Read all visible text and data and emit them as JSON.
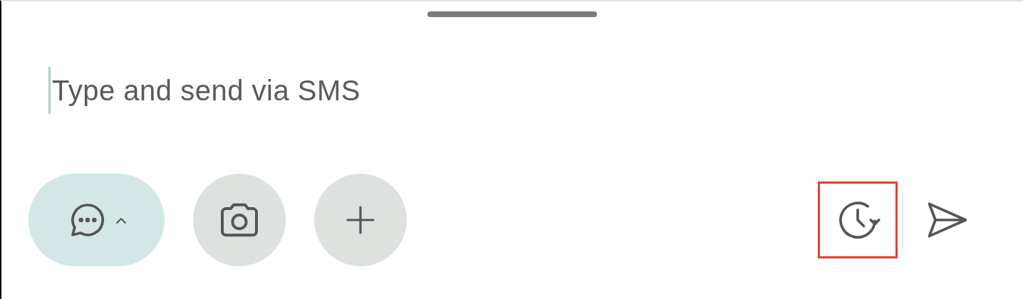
{
  "composer": {
    "placeholder": "Type and send via SMS",
    "focused": true
  },
  "left_actions": [
    {
      "kind": "message-type",
      "expanded": false
    },
    {
      "kind": "camera"
    },
    {
      "kind": "add"
    }
  ],
  "right_actions": [
    {
      "kind": "schedule",
      "highlighted": true
    },
    {
      "kind": "send",
      "highlighted": false
    }
  ]
}
